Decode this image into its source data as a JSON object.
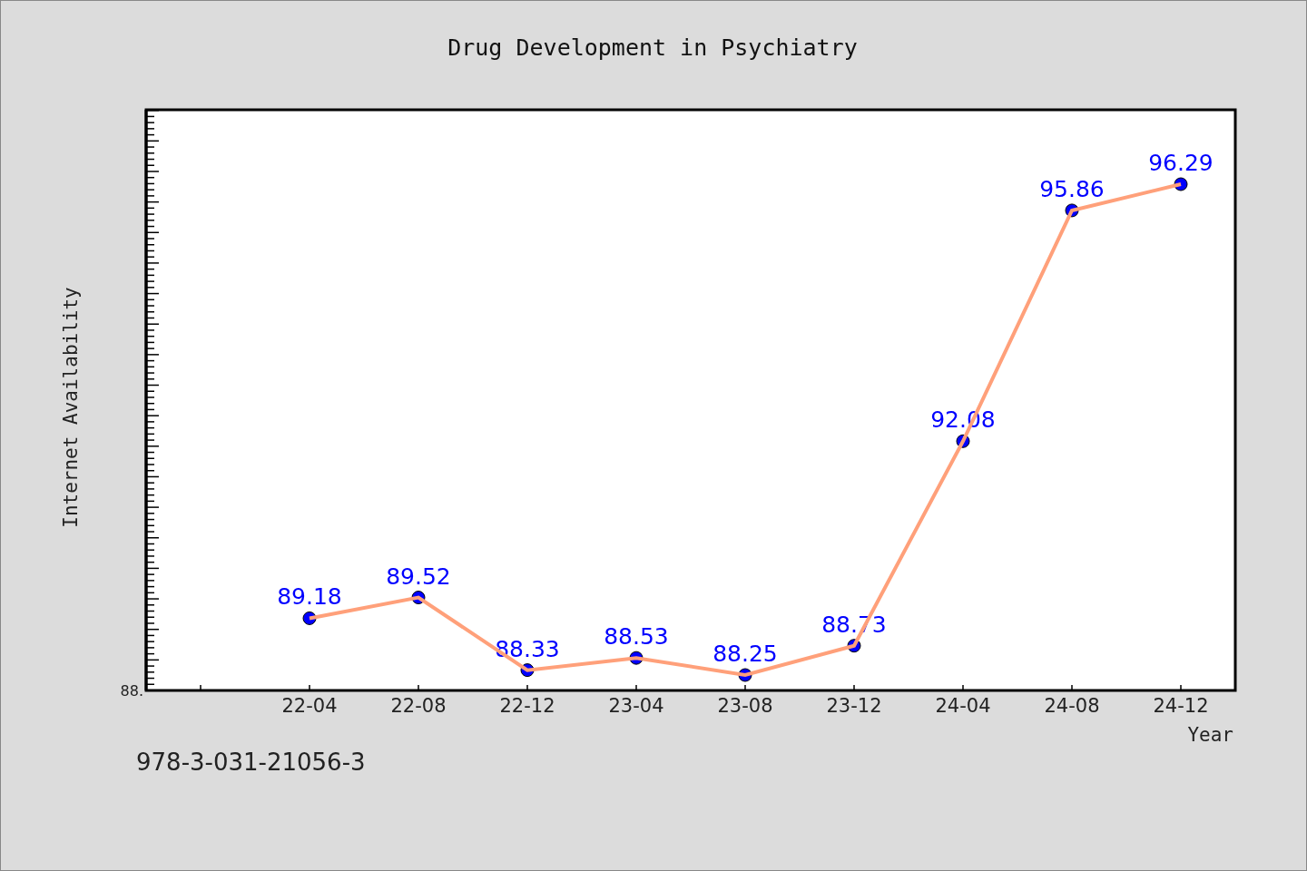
{
  "chart_data": {
    "type": "line",
    "title": "Drug Development in Psychiatry",
    "xlabel": "Year",
    "categories": [
      "22-04",
      "22-08",
      "22-12",
      "23-04",
      "23-08",
      "23-12",
      "24-04",
      "24-08",
      "24-12"
    ],
    "series": [
      {
        "color": "#ffa07a",
        "marker": "circle",
        "values": [
          89.18,
          89.52,
          88.33,
          88.53,
          88.25,
          88.73,
          92.08,
          95.86,
          96.29
        ]
      }
    ],
    "annotations": [
      {
        "text": "88."
      },
      {
        "text": "Internet Availability"
      }
    ],
    "data_labels": true
  },
  "footer": {
    "text": "978-3-031-21056-3"
  }
}
